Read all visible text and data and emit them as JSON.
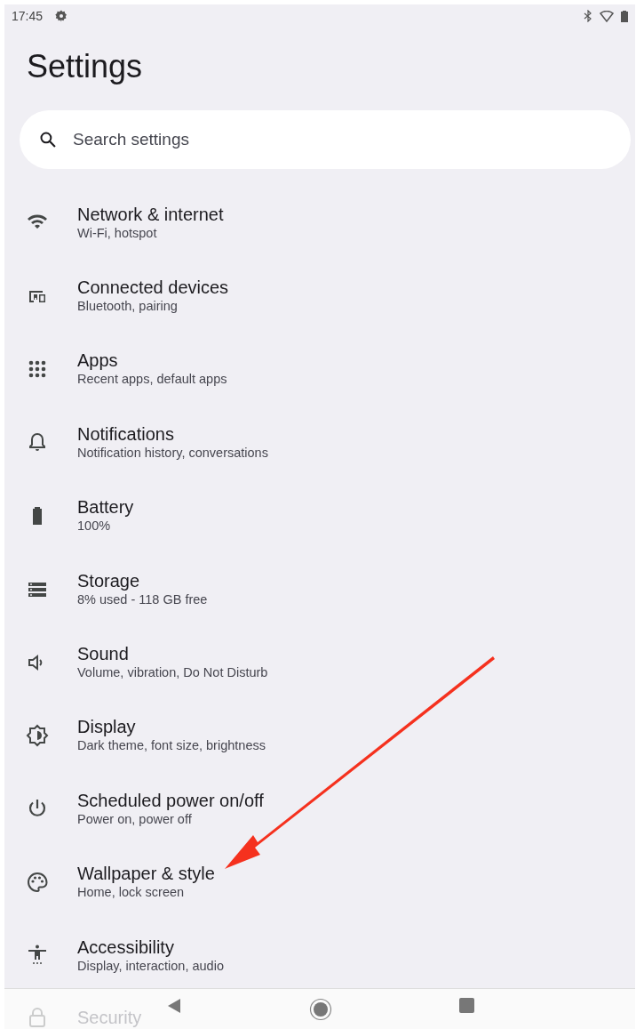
{
  "status_bar": {
    "time": "17:45"
  },
  "title": "Settings",
  "search": {
    "placeholder": "Search settings"
  },
  "items": [
    {
      "kind": "item",
      "title": "Network & internet",
      "subtitle": "Wi-Fi, hotspot"
    },
    {
      "kind": "item",
      "title": "Connected devices",
      "subtitle": "Bluetooth, pairing"
    },
    {
      "kind": "item",
      "title": "Apps",
      "subtitle": "Recent apps, default apps"
    },
    {
      "kind": "item",
      "title": "Notifications",
      "subtitle": "Notification history, conversations"
    },
    {
      "kind": "item",
      "title": "Battery",
      "subtitle": "100%"
    },
    {
      "kind": "item",
      "title": "Storage",
      "subtitle": "8% used - 118 GB free"
    },
    {
      "kind": "item",
      "title": "Sound",
      "subtitle": "Volume, vibration, Do Not Disturb"
    },
    {
      "kind": "item",
      "title": "Display",
      "subtitle": "Dark theme, font size, brightness"
    },
    {
      "kind": "item",
      "title": "Scheduled power on/off",
      "subtitle": "Power on, power off"
    },
    {
      "kind": "item",
      "title": "Wallpaper & style",
      "subtitle": "Home, lock screen"
    },
    {
      "kind": "item",
      "title": "Accessibility",
      "subtitle": "Display, interaction, audio"
    },
    {
      "kind": "peek",
      "title": "Security"
    }
  ]
}
